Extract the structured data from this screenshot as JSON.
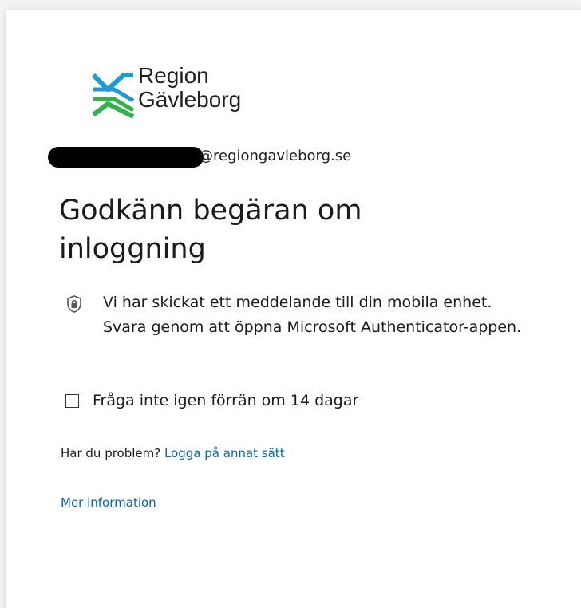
{
  "brand": {
    "line1": "Region",
    "line2": "Gävleborg",
    "accent_blue": "#1e9ad6",
    "accent_green": "#2eb24a"
  },
  "account": {
    "domain": "@regiongavleborg.se"
  },
  "title": "Godkänn begäran om inloggning",
  "notice": {
    "text": "Vi har skickat ett meddelande till din mobila enhet. Svara genom att öppna Microsoft Authenticator-appen.",
    "icon": "shield-lock-icon"
  },
  "remember": {
    "label": "Fråga inte igen förrän om 14 dagar",
    "checked": false
  },
  "help": {
    "prefix": "Har du problem? ",
    "link_label": "Logga på annat sätt"
  },
  "more_info": "Mer information",
  "colors": {
    "link": "#0067b8",
    "text": "#1b1b1b"
  }
}
